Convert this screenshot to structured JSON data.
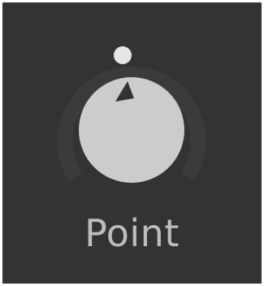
{
  "knob": {
    "label": "Point",
    "value": 0.5
  },
  "colors": {
    "background": "#333333",
    "track": "#3b3b3b",
    "knob_face": "#cccccc",
    "pointer": "#333333",
    "value_dot": "#e6e6e6",
    "label": "#bdbdbd"
  }
}
